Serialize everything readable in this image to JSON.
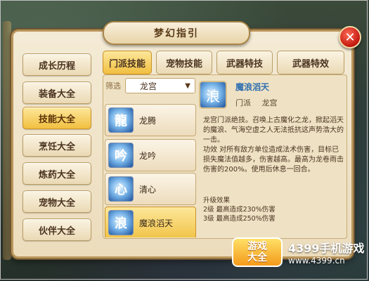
{
  "window": {
    "title": "梦幻指引"
  },
  "sidebar": {
    "items": [
      {
        "label": "成长历程",
        "active": false
      },
      {
        "label": "装备大全",
        "active": false
      },
      {
        "label": "技能大全",
        "active": true
      },
      {
        "label": "烹饪大全",
        "active": false
      },
      {
        "label": "炼药大全",
        "active": false
      },
      {
        "label": "宠物大全",
        "active": false
      },
      {
        "label": "伙伴大全",
        "active": false
      }
    ]
  },
  "tabs": [
    {
      "label": "门派技能",
      "active": true
    },
    {
      "label": "宠物技能",
      "active": false
    },
    {
      "label": "武器特技",
      "active": false
    },
    {
      "label": "武器特效",
      "active": false
    }
  ],
  "filter": {
    "label": "筛选",
    "value": "龙宫"
  },
  "skills": [
    {
      "name": "龙腾",
      "icon": "dragon-skill-icon",
      "selected": false
    },
    {
      "name": "龙吟",
      "icon": "dragon-roar-icon",
      "selected": false
    },
    {
      "name": "清心",
      "icon": "clear-mind-icon",
      "selected": false
    },
    {
      "name": "魔浪滔天",
      "icon": "wave-skill-icon",
      "selected": true
    }
  ],
  "detail": {
    "title": "魔浪滔天",
    "school_label": "门派",
    "school_value": "龙宫",
    "description": "龙宫门派绝技。召唤上古魔化之龙，掀起滔天的魔浪、气海空虚之人无法抵抗这声势浩大的一击。",
    "effect": "功效  对所有敌方单位造成法术伤害，目标已损失魔法值越多，伤害越高。最高为龙卷雨击伤害的200%。使用后休息一回合。",
    "upgrade_title": "升级效果",
    "upgrade_lines": [
      "2级  最高造成230%伤害",
      "3级  最高造成250%伤害"
    ]
  },
  "watermark": {
    "badge_line1": "游戏",
    "badge_line2": "大全",
    "brand": "4399手机游戏",
    "url": "www.4399.cn"
  },
  "colors": {
    "accent": "#f1bf40",
    "close": "#c2180f",
    "title_link": "#2f6fb0"
  }
}
